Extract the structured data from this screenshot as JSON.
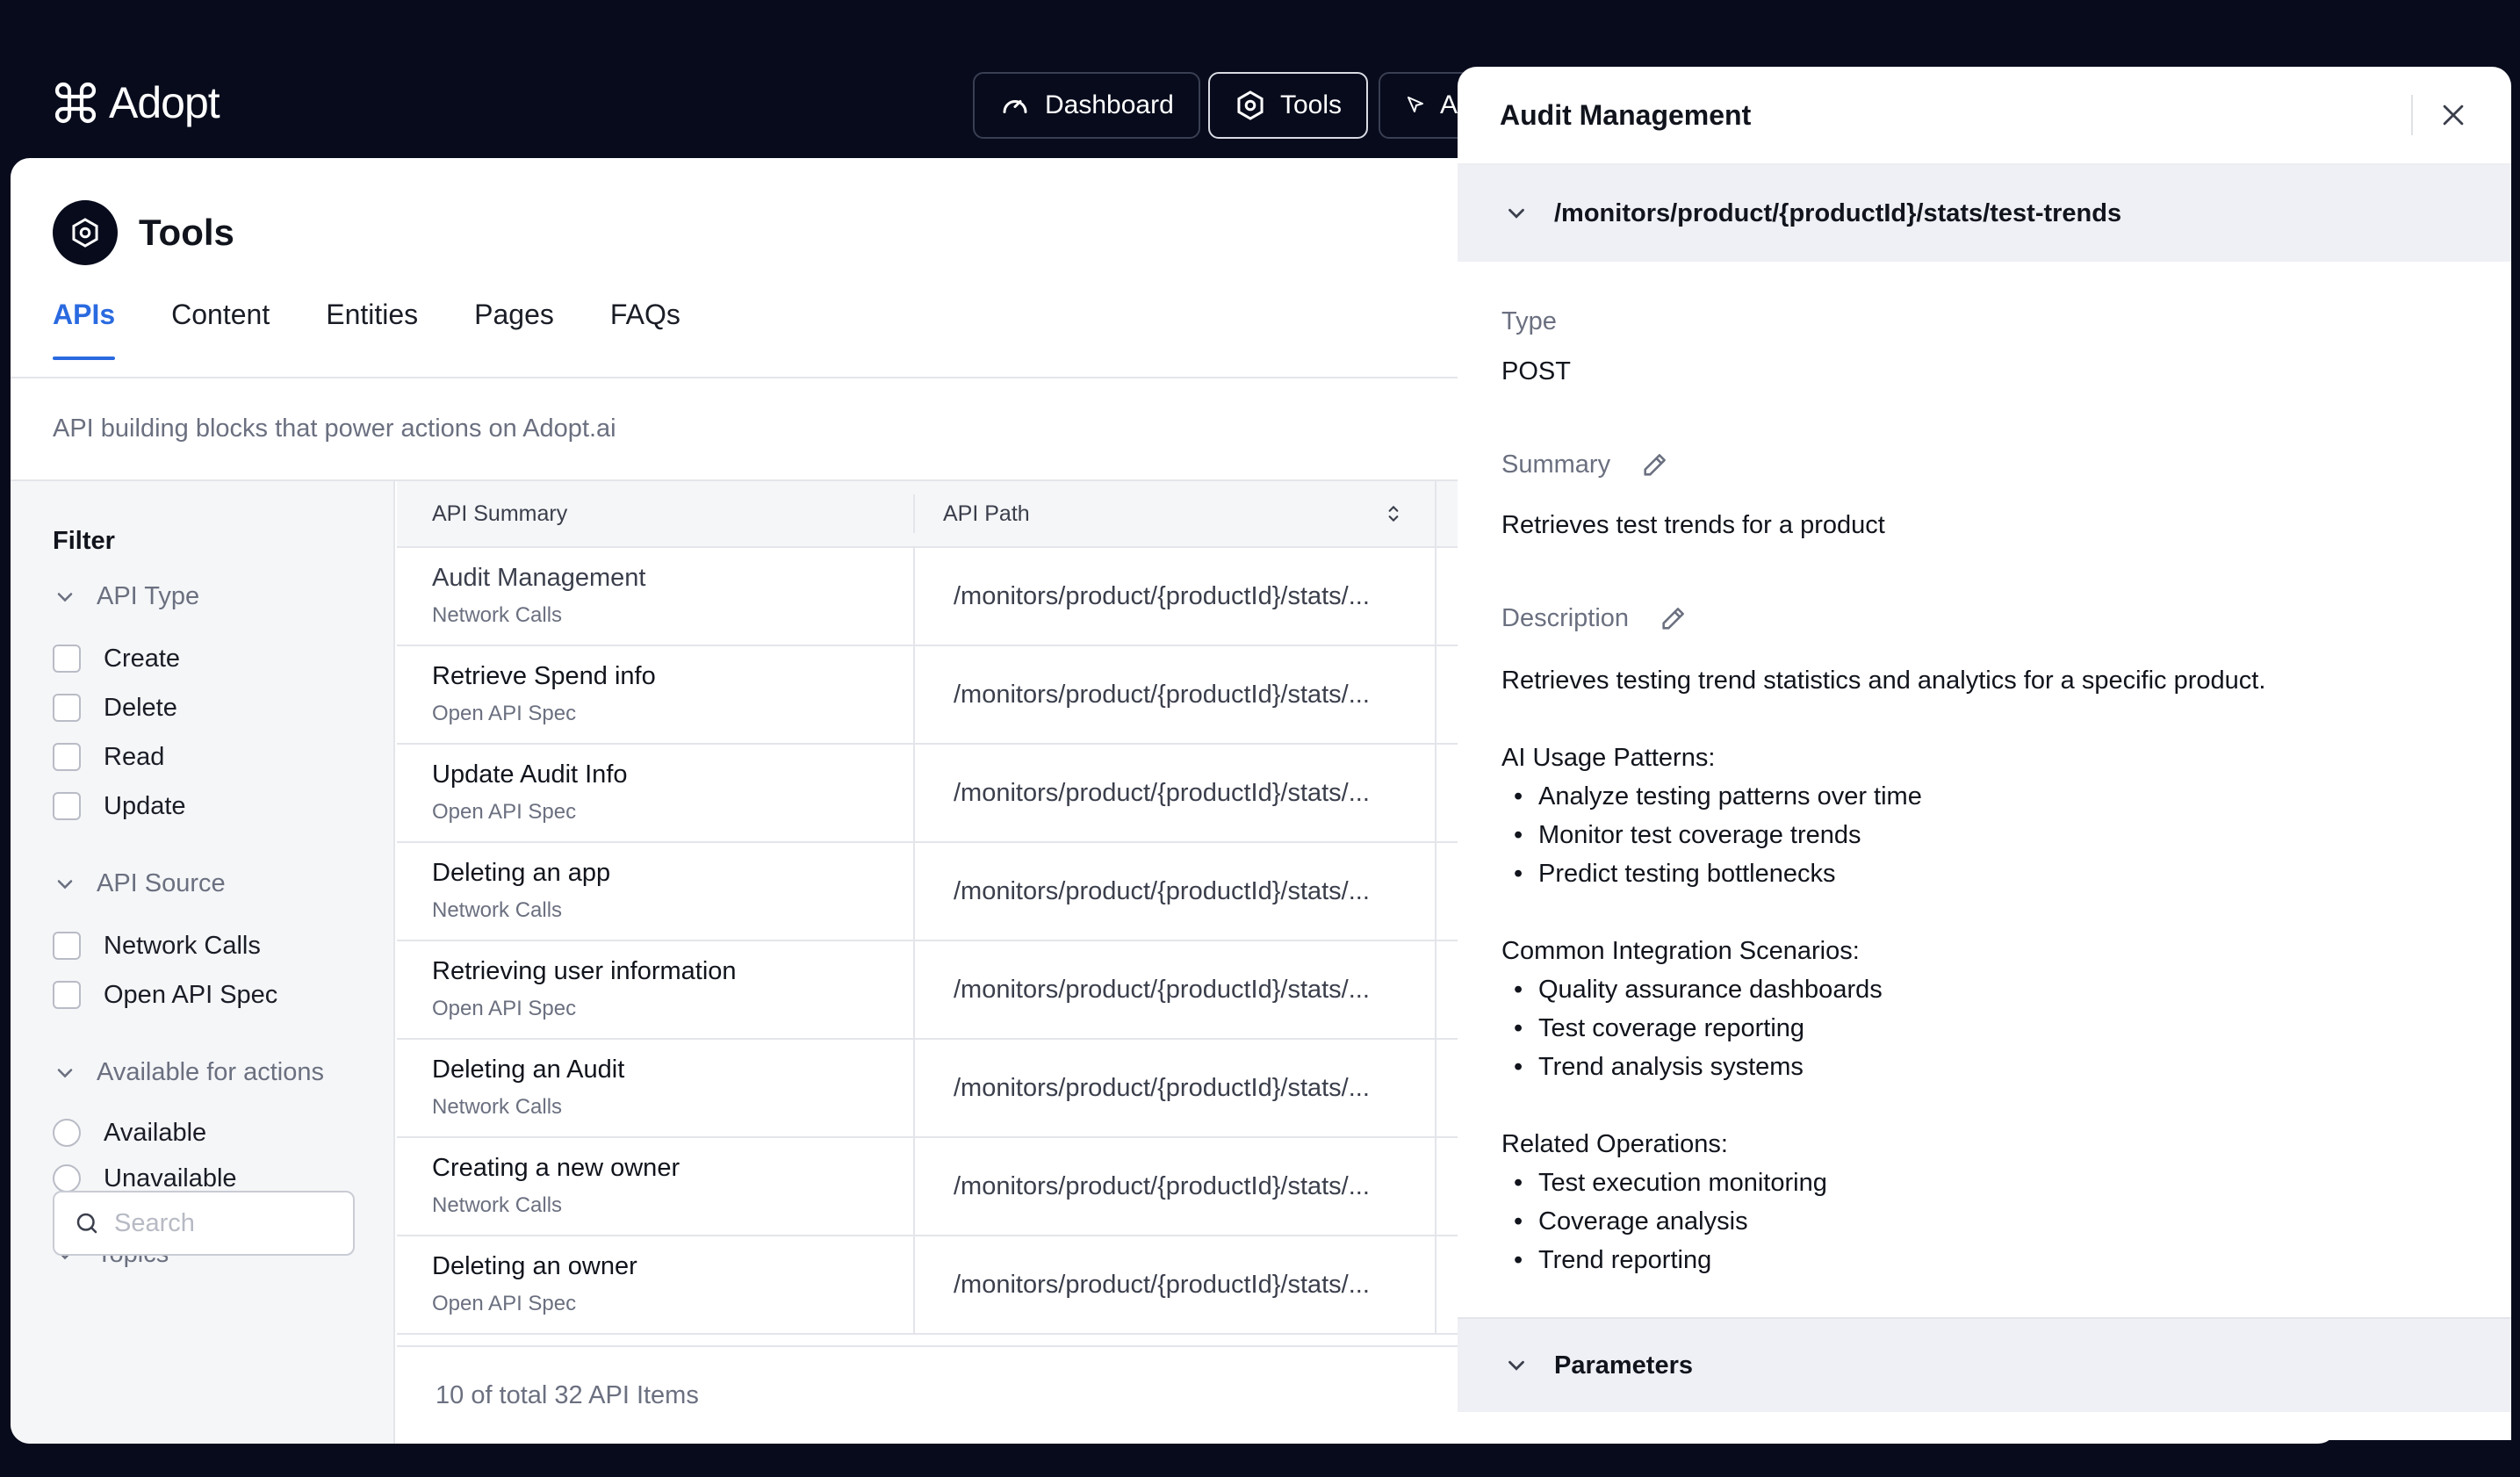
{
  "app": {
    "name": "Adopt"
  },
  "nav": {
    "items": [
      {
        "label": "Dashboard",
        "icon": "gauge-icon"
      },
      {
        "label": "Tools",
        "icon": "hexagon-gear-icon"
      },
      {
        "label": "A",
        "icon": "cursor-arrow-icon"
      }
    ]
  },
  "page": {
    "title": "Tools",
    "subtitle": "API building blocks that power actions on Adopt.ai",
    "tabs": [
      "APIs",
      "Content",
      "Entities",
      "Pages",
      "FAQs"
    ],
    "active_tab": "APIs"
  },
  "filter": {
    "title": "Filter",
    "groups": [
      {
        "name": "API Type",
        "type": "checkbox",
        "options": [
          "Create",
          "Delete",
          "Read",
          "Update"
        ]
      },
      {
        "name": "API Source",
        "type": "checkbox",
        "options": [
          "Network Calls",
          "Open API Spec"
        ]
      },
      {
        "name": "Available for actions",
        "type": "radio",
        "options": [
          "Available",
          "Unavailable"
        ]
      },
      {
        "name": "Topics"
      }
    ],
    "search_placeholder": "Search"
  },
  "table": {
    "columns": [
      "API Summary",
      "API Path"
    ],
    "rows": [
      {
        "title": "Audit Management",
        "source": "Network Calls",
        "path": "/monitors/product/{productId}/stats/..."
      },
      {
        "title": "Retrieve Spend info",
        "source": "Open API Spec",
        "path": "/monitors/product/{productId}/stats/..."
      },
      {
        "title": "Update Audit Info",
        "source": "Open API Spec",
        "path": "/monitors/product/{productId}/stats/..."
      },
      {
        "title": "Deleting an app",
        "source": "Network Calls",
        "path": "/monitors/product/{productId}/stats/..."
      },
      {
        "title": "Retrieving user information",
        "source": "Open API Spec",
        "path": "/monitors/product/{productId}/stats/..."
      },
      {
        "title": "Deleting an Audit",
        "source": "Network Calls",
        "path": "/monitors/product/{productId}/stats/..."
      },
      {
        "title": "Creating a new owner",
        "source": "Network Calls",
        "path": "/monitors/product/{productId}/stats/..."
      },
      {
        "title": "Deleting an owner",
        "source": "Open API Spec",
        "path": "/monitors/product/{productId}/stats/..."
      }
    ],
    "footer": "10 of total 32 API Items"
  },
  "panel": {
    "title": "Audit Management",
    "path": "/monitors/product/{productId}/stats/test-trends",
    "type_label": "Type",
    "type_value": "POST",
    "summary_label": "Summary",
    "summary_value": "Retrieves test trends for a product",
    "description_label": "Description",
    "description_intro": "Retrieves testing trend statistics and analytics for a specific product.",
    "description_sections": [
      {
        "heading": "AI Usage Patterns:",
        "items": [
          "Analyze testing patterns over time",
          "Monitor test coverage trends",
          "Predict testing bottlenecks"
        ]
      },
      {
        "heading": "Common Integration Scenarios:",
        "items": [
          "Quality assurance dashboards",
          "Test coverage reporting",
          "Trend analysis systems"
        ]
      },
      {
        "heading": "Related Operations:",
        "items": [
          "Test execution monitoring",
          "Coverage analysis",
          "Trend reporting"
        ]
      }
    ],
    "parameters_label": "Parameters"
  },
  "colors": {
    "background": "#070b1c",
    "accent": "#2a6ae0",
    "panel_section": "#eef0f5"
  }
}
